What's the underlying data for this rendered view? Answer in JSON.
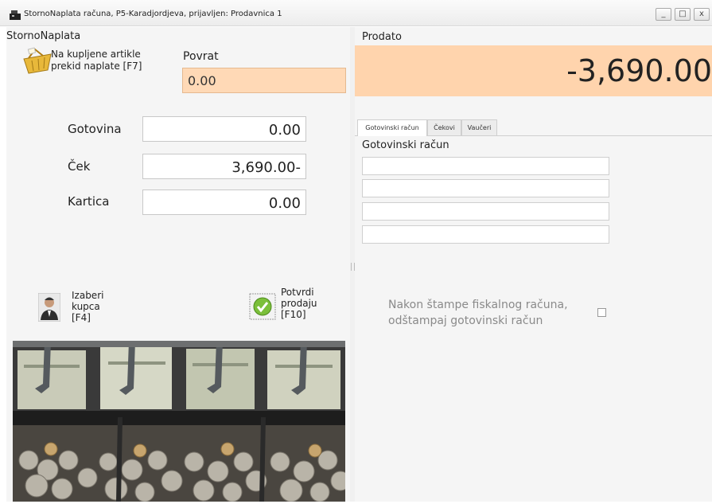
{
  "window": {
    "title": "StornoNaplata računa, P5-Karadjordjeva, prijavljen: Prodavnica 1",
    "minimize": "_",
    "maximize": "□",
    "close": "x"
  },
  "left": {
    "title": "StornoNaplata",
    "storno_action_label": "Na kupljene artikle\nprekid naplate [F7]",
    "povrat_label": "Povrat",
    "povrat_value": "0.00",
    "payments": [
      {
        "label": "Gotovina",
        "value": "0.00"
      },
      {
        "label": "Ček",
        "value": "3,690.00-"
      },
      {
        "label": "Kartica",
        "value": "0.00"
      }
    ],
    "choose_customer_label": "Izaberi\nkupca\n[F4]",
    "confirm_sale_label": "Potvrdi\nprodaju\n[F10]"
  },
  "right": {
    "title": "Prodato",
    "total": "-3,690.00",
    "tabs": [
      "Gotovinski račun",
      "Čekovi",
      "Vaučeri"
    ],
    "active_tab": "Gotovinski račun",
    "section_title": "Gotovinski račun",
    "fields": [
      "",
      "",
      "",
      ""
    ],
    "print_option_label": "Nakon štampe fiskalnog računa,\nodštampaj gotovinski račun",
    "print_option_checked": false
  },
  "icons": {
    "app": "cash-register-icon",
    "storno": "basket-icon",
    "customer": "user-icon",
    "confirm": "checkmark-icon"
  },
  "colors": {
    "total_background": "#ffd4ad",
    "povrat_background": "#ffd9b6",
    "panel_background": "#f5f5f5"
  }
}
